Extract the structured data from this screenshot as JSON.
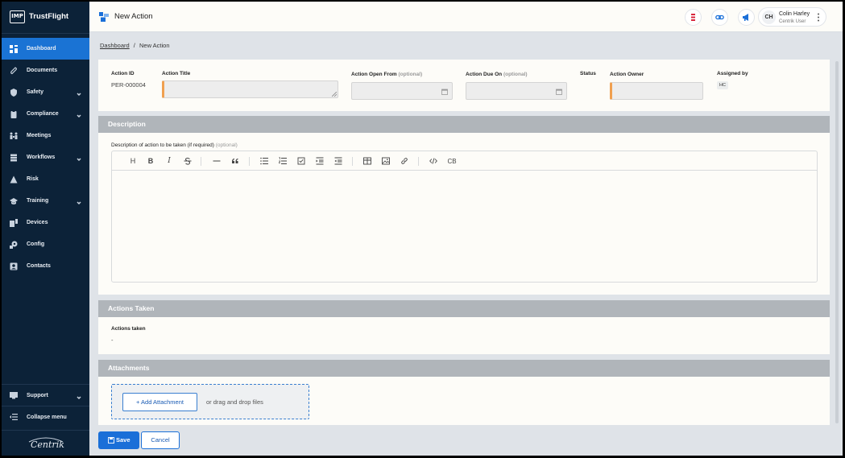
{
  "brand": {
    "logo_text": "IMP",
    "name": "TrustFlight"
  },
  "sidebar": {
    "items": [
      {
        "label": "Dashboard",
        "icon": "dashboard-icon",
        "active": true,
        "chevron": false
      },
      {
        "label": "Documents",
        "icon": "paperclip-icon",
        "active": false,
        "chevron": false
      },
      {
        "label": "Safety",
        "icon": "shield-icon",
        "active": false,
        "chevron": true
      },
      {
        "label": "Compliance",
        "icon": "clipboard-icon",
        "active": false,
        "chevron": true
      },
      {
        "label": "Meetings",
        "icon": "meetings-icon",
        "active": false,
        "chevron": false
      },
      {
        "label": "Workflows",
        "icon": "layers-icon",
        "active": false,
        "chevron": true
      },
      {
        "label": "Risk",
        "icon": "risk-icon",
        "active": false,
        "chevron": false
      },
      {
        "label": "Training",
        "icon": "graduation-cap-icon",
        "active": false,
        "chevron": true
      },
      {
        "label": "Devices",
        "icon": "devices-icon",
        "active": false,
        "chevron": false
      },
      {
        "label": "Config",
        "icon": "config-icon",
        "active": false,
        "chevron": false
      },
      {
        "label": "Contacts",
        "icon": "contacts-icon",
        "active": false,
        "chevron": false
      }
    ],
    "support_label": "Support",
    "collapse_label": "Collapse menu",
    "footer_brand": "Centrik"
  },
  "header": {
    "title": "New Action",
    "user": {
      "initials": "CH",
      "name": "Colin Harley",
      "role": "Centrik User"
    }
  },
  "breadcrumb": {
    "home": "Dashboard",
    "separator": "/",
    "current": "New Action"
  },
  "form": {
    "action_id_label": "Action ID",
    "action_id_value": "PER-000004",
    "action_title_label": "Action Title",
    "open_from_label": "Action Open From",
    "due_on_label": "Action Due On",
    "optional": "(optional)",
    "status_label": "Status",
    "owner_label": "Action Owner",
    "assigned_by_label": "Assigned by",
    "assigned_by_value": "HC"
  },
  "description": {
    "title": "Description",
    "field_label": "Description of action to be taken (if required)",
    "optional": "(optional)",
    "toolbar": {
      "heading": "H",
      "bold": "B",
      "italic": "I",
      "code_block": "CB"
    }
  },
  "actions_taken": {
    "title": "Actions Taken",
    "label": "Actions taken",
    "value": "-"
  },
  "attachments": {
    "title": "Attachments",
    "add_button": "+ Add Attachment",
    "drop_text": "or drag and drop files"
  },
  "buttons": {
    "save": "Save",
    "cancel": "Cancel"
  },
  "colors": {
    "sidebar_bg": "#0c2238",
    "accent": "#1a6fd8",
    "required": "#f0a050",
    "section_head": "#b0b5ba"
  }
}
